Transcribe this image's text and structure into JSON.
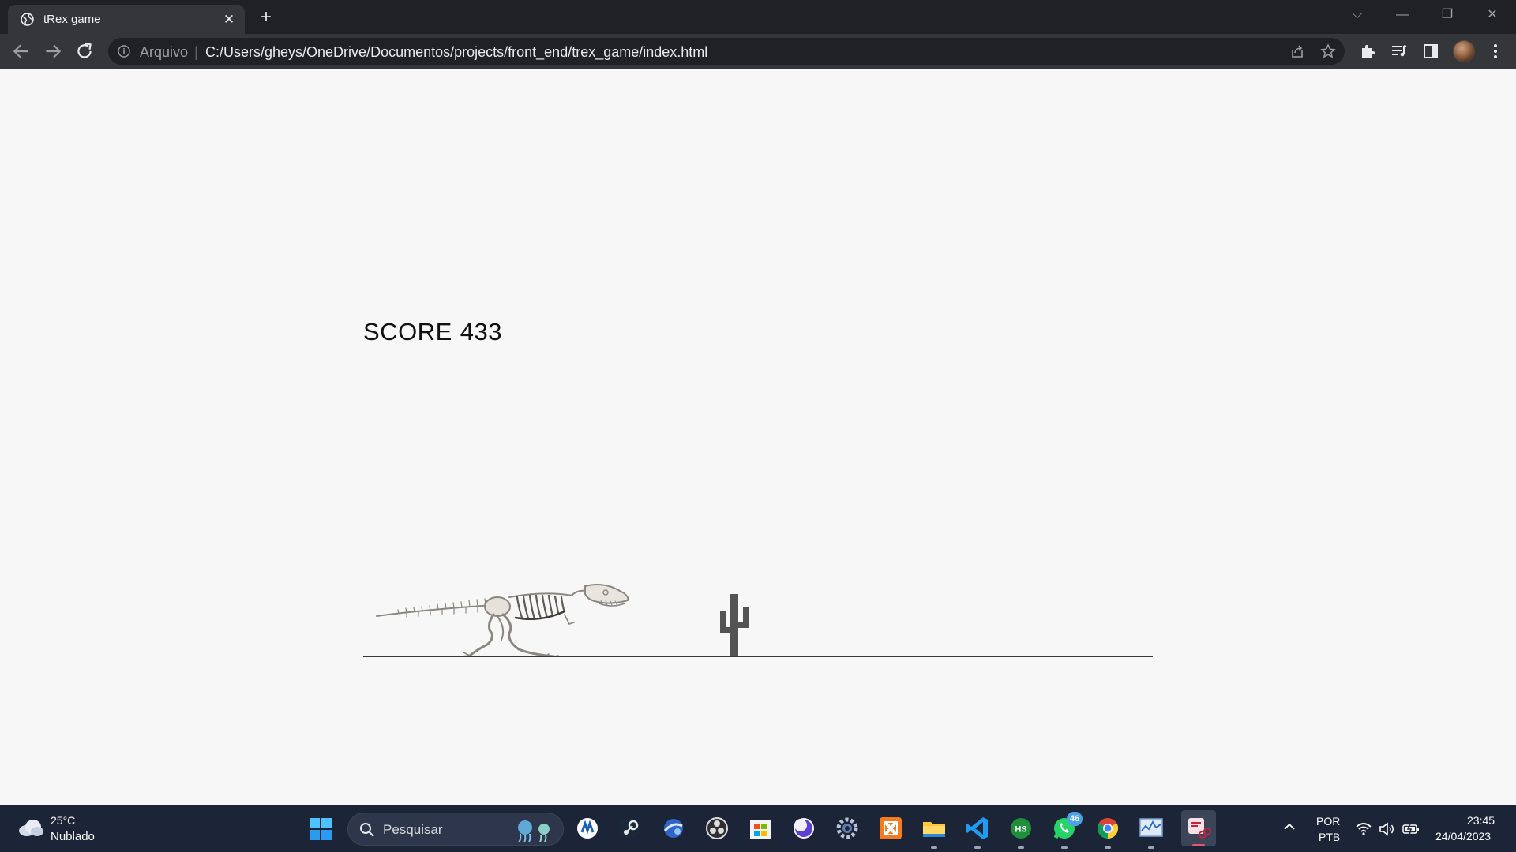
{
  "browser": {
    "tab": {
      "title": "tRex game",
      "close_glyph": "✕",
      "new_tab_glyph": "+"
    },
    "address_bar": {
      "scheme_label": "Arquivo",
      "separator": "|",
      "url": "C:/Users/gheys/OneDrive/Documentos/projects/front_end/trex_game/index.html"
    },
    "window_controls": {
      "dropdown": "⌵",
      "minimize": "—",
      "restore": "❐",
      "close": "✕"
    },
    "icons": [
      "back-arrow-icon",
      "forward-arrow-icon",
      "reload-icon",
      "site-info-icon",
      "share-icon",
      "bookmark-star-icon",
      "extensions-puzzle-icon",
      "media-queue-icon",
      "side-panel-icon",
      "profile-avatar",
      "menu-dots-icon"
    ]
  },
  "game": {
    "score_label": "SCORE",
    "score_value": "433",
    "sprites": [
      "trex-skeleton",
      "cactus-obstacle"
    ],
    "colors": {
      "background": "#f7f7f7",
      "ground": "#3a3a3a",
      "cactus": "#535353",
      "text": "#111111"
    }
  },
  "taskbar": {
    "weather": {
      "temp": "25°C",
      "condition": "Nublado"
    },
    "search_placeholder": "Pesquisar",
    "apps": [
      {
        "name": "edge-ai-app-icon"
      },
      {
        "name": "steam-icon"
      },
      {
        "name": "globe-browser-icon"
      },
      {
        "name": "obs-studio-icon"
      },
      {
        "name": "microsoft-store-icon"
      },
      {
        "name": "moon-app-icon"
      },
      {
        "name": "settings-gear-icon"
      },
      {
        "name": "xampp-icon"
      },
      {
        "name": "file-explorer-icon"
      },
      {
        "name": "vscode-icon"
      },
      {
        "name": "hs-app-icon"
      },
      {
        "name": "whatsapp-icon",
        "badge": "46"
      },
      {
        "name": "chrome-icon"
      },
      {
        "name": "performance-monitor-icon"
      },
      {
        "name": "snipping-tool-icon"
      }
    ],
    "tray": {
      "lang_line1": "POR",
      "lang_line2": "PTB",
      "time": "23:45",
      "date": "24/04/2023"
    }
  }
}
